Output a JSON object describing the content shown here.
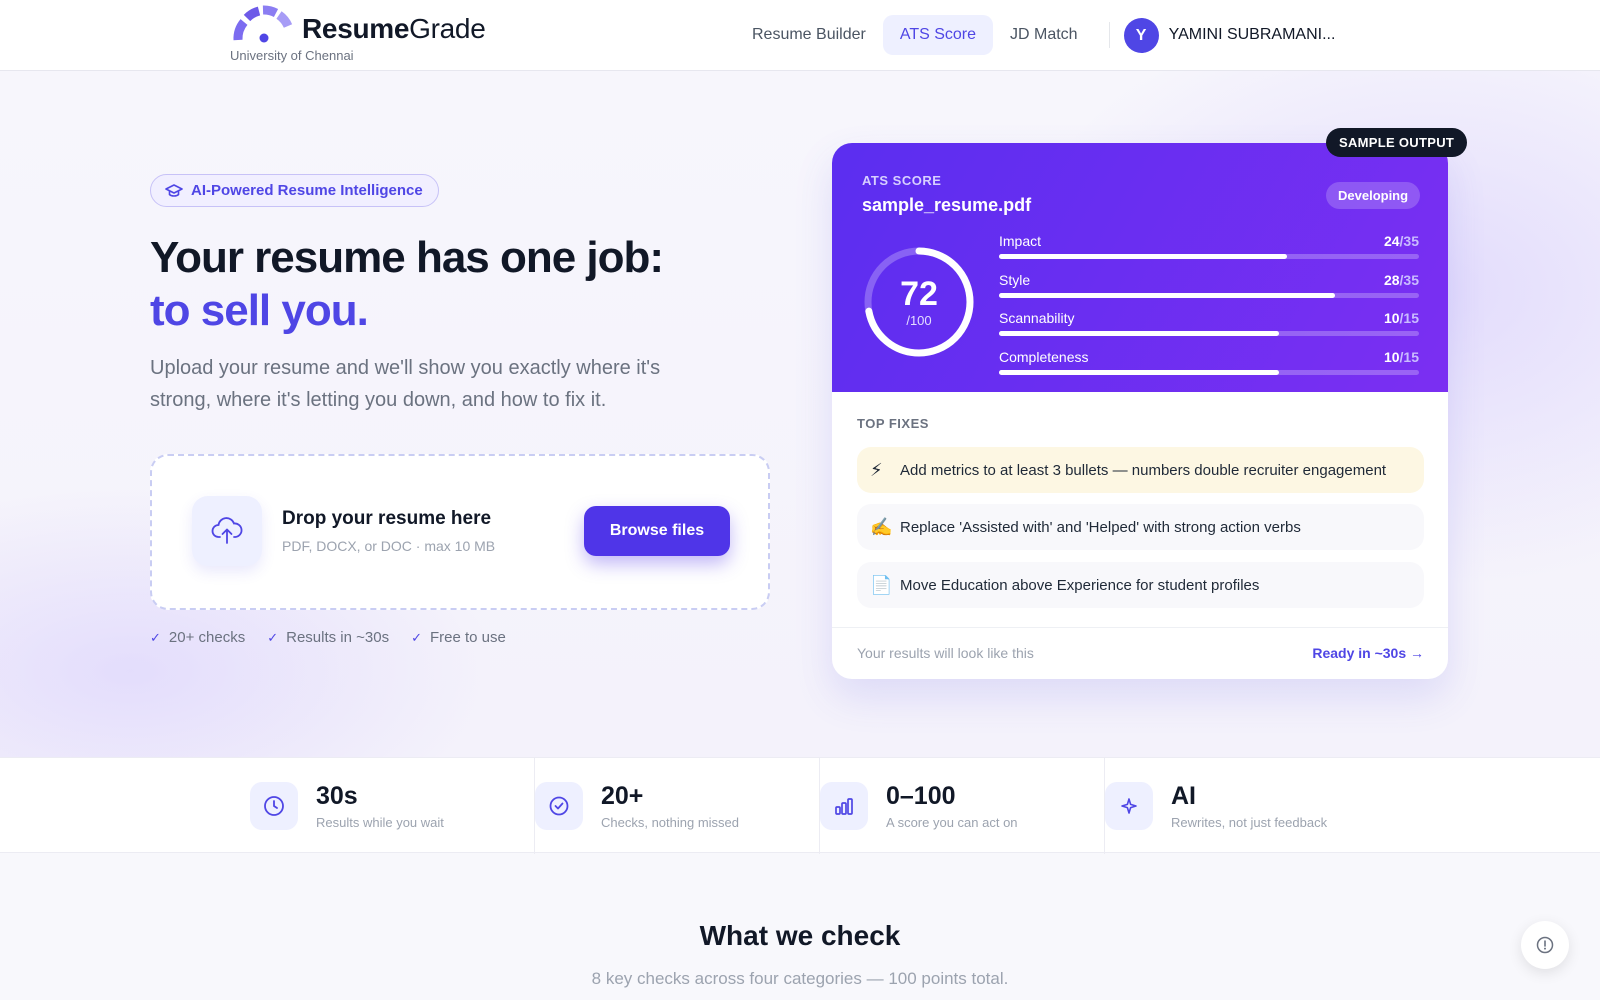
{
  "brand": {
    "name_bold": "Resume",
    "name_regular": "Grade",
    "institution": "University of Chennai"
  },
  "nav": {
    "items": [
      {
        "label": "Resume Builder",
        "active": false
      },
      {
        "label": "ATS Score",
        "active": true
      },
      {
        "label": "JD Match",
        "active": false
      }
    ],
    "user": {
      "initial": "Y",
      "name": "YAMINI SUBRAMANI..."
    }
  },
  "hero": {
    "pill": "AI-Powered Resume Intelligence",
    "headline_line1": "Your resume has one job:",
    "headline_line2": "to sell you.",
    "subtext": "Upload your resume and we'll show you exactly where it's strong, where it's letting you down, and how to fix it.",
    "dropzone": {
      "title": "Drop your resume here",
      "subtitle": "PDF, DOCX, or DOC · max 10 MB",
      "button": "Browse files"
    },
    "checks": [
      "20+ checks",
      "Results in ~30s",
      "Free to use"
    ]
  },
  "score_card": {
    "badge": "SAMPLE OUTPUT",
    "label": "ATS SCORE",
    "file_name": "sample_resume.pdf",
    "status": "Developing",
    "score": "72",
    "score_max": "/100",
    "score_fraction": 0.72,
    "metrics": [
      {
        "label": "Impact",
        "value": "24",
        "max": "/35",
        "fraction": 0.686
      },
      {
        "label": "Style",
        "value": "28",
        "max": "/35",
        "fraction": 0.8
      },
      {
        "label": "Scannability",
        "value": "10",
        "max": "/15",
        "fraction": 0.667
      },
      {
        "label": "Completeness",
        "value": "10",
        "max": "/15",
        "fraction": 0.667
      }
    ],
    "fixes_title": "TOP FIXES",
    "fixes": [
      {
        "icon": "⚡",
        "text": "Add metrics to at least 3 bullets — numbers double recruiter engagement"
      },
      {
        "icon": "✍️",
        "text": "Replace 'Assisted with' and 'Helped' with strong action verbs"
      },
      {
        "icon": "📄",
        "text": "Move Education above Experience for student profiles"
      }
    ],
    "footer_note": "Your results will look like this",
    "footer_link": "Ready in ~30s →"
  },
  "stats": [
    {
      "icon": "clock-icon",
      "value": "30s",
      "label": "Results while you wait"
    },
    {
      "icon": "check-circle-icon",
      "value": "20+",
      "label": "Checks, nothing missed"
    },
    {
      "icon": "bar-chart-icon",
      "value": "0–100",
      "label": "A score you can act on"
    },
    {
      "icon": "sparkle-icon",
      "value": "AI",
      "label": "Rewrites, not just feedback"
    }
  ],
  "what_we_check": {
    "title": "What we check",
    "subtitle": "8 key checks across four categories — 100 points total."
  },
  "colors": {
    "accent": "#4f46e5",
    "card_gradient_start": "#5b2ef0",
    "card_gradient_end": "#7b2ff2"
  }
}
